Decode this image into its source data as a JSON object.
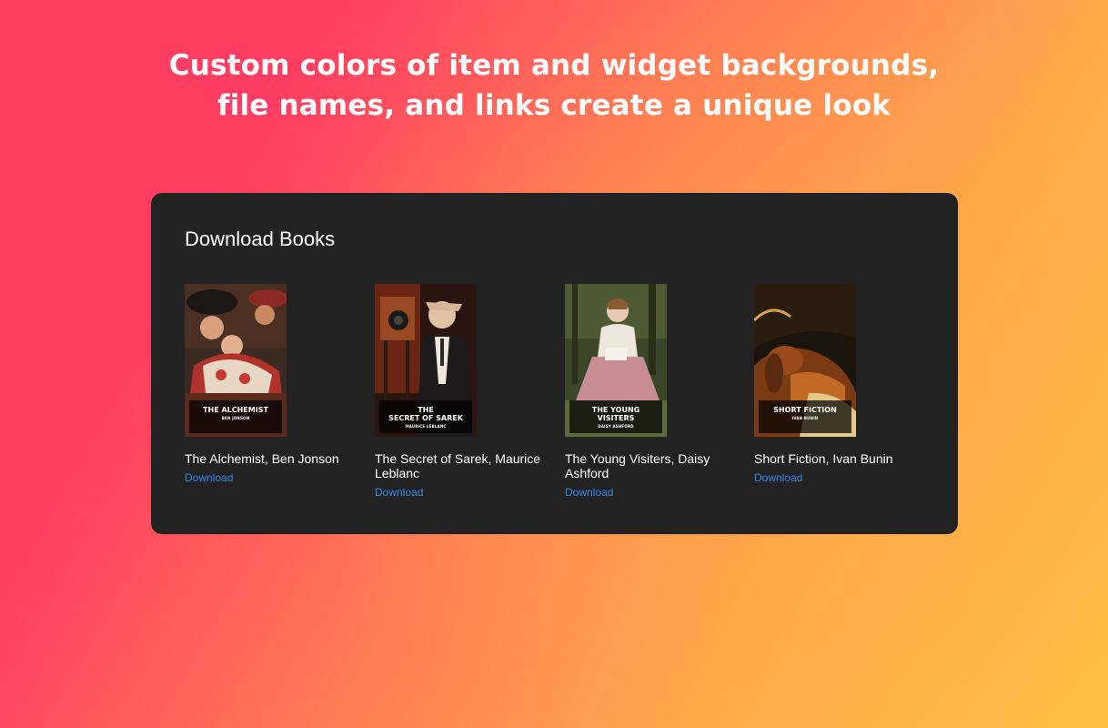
{
  "headline": {
    "line1": "Custom colors of item and widget backgrounds,",
    "line2": "file names, and links create a unique look"
  },
  "widget": {
    "title": "Download Books",
    "books": [
      {
        "cover_title": "THE ALCHEMIST",
        "cover_author": "BEN JONSON",
        "caption": "The Alchemist, Ben Jonson",
        "link": "Download",
        "cover_colors": [
          "#5a2a1e",
          "#b0322a",
          "#e8c7a8",
          "#2b2626"
        ]
      },
      {
        "cover_title": "THE\nSECRET OF SAREK",
        "cover_author": "MAURICE LEBLANC",
        "caption": "The Secret of Sarek, Maurice Leblanc",
        "link": "Download",
        "cover_colors": [
          "#3a1610",
          "#9a4a22",
          "#e6d2c0",
          "#1c1a1a"
        ]
      },
      {
        "cover_title": "THE YOUNG\nVISITERS",
        "cover_author": "DAISY ASHFORD",
        "caption": "The Young Visiters, Daisy Ashford",
        "link": "Download",
        "cover_colors": [
          "#2e3a20",
          "#5f6a3a",
          "#e9c9b4",
          "#c98d94"
        ]
      },
      {
        "cover_title": "SHORT FICTION",
        "cover_author": "IVAN BUNIN",
        "caption": "Short Fiction, Ivan Bunin",
        "link": "Download",
        "cover_colors": [
          "#1a140c",
          "#7a3a14",
          "#c06a26",
          "#e3c88a"
        ]
      }
    ]
  }
}
